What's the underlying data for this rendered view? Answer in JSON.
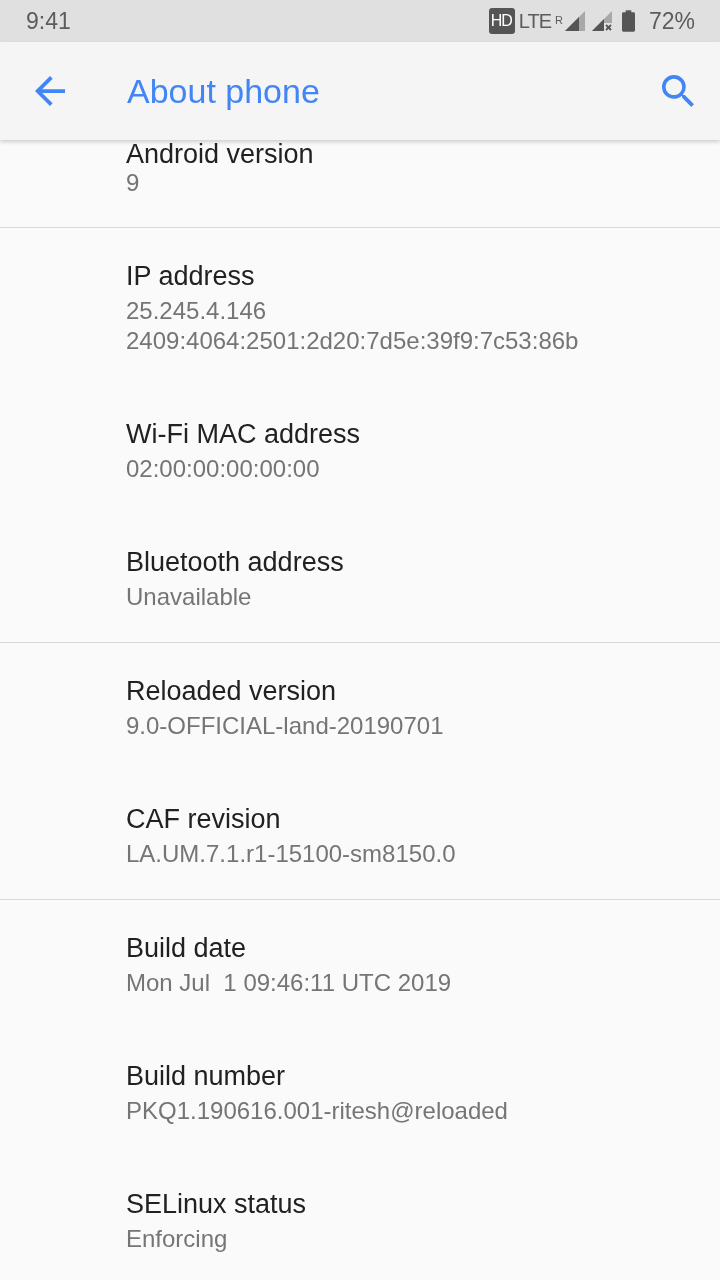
{
  "status_bar": {
    "time": "9:41",
    "network_badge": "HD",
    "network_type": "LTE",
    "roaming_indicator": "R",
    "battery_percent": "72%"
  },
  "app_bar": {
    "title": "About phone"
  },
  "sections": [
    {
      "items": [
        {
          "title": "Android version",
          "summary": [
            "9"
          ]
        }
      ]
    },
    {
      "items": [
        {
          "title": "IP address",
          "summary": [
            "25.245.4.146",
            "2409:4064:2501:2d20:7d5e:39f9:7c53:86b"
          ]
        },
        {
          "title": "Wi-Fi MAC address",
          "summary": [
            "02:00:00:00:00:00"
          ]
        },
        {
          "title": "Bluetooth address",
          "summary": [
            "Unavailable"
          ]
        }
      ]
    },
    {
      "items": [
        {
          "title": "Reloaded version",
          "summary": [
            "9.0-OFFICIAL-land-20190701"
          ]
        },
        {
          "title": "CAF revision",
          "summary": [
            "LA.UM.7.1.r1-15100-sm8150.0"
          ]
        }
      ]
    },
    {
      "items": [
        {
          "title": "Build date",
          "summary": [
            "Mon Jul  1 09:46:11 UTC 2019"
          ]
        },
        {
          "title": "Build number",
          "summary": [
            "PKQ1.190616.001-ritesh@reloaded"
          ]
        },
        {
          "title": "SELinux status",
          "summary": [
            "Enforcing"
          ]
        }
      ]
    }
  ]
}
